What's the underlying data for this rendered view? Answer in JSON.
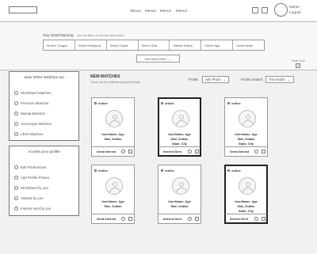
{
  "nav": [
    "Menu1",
    "Menu2",
    "Menu3",
    "Menu4"
  ],
  "header": {
    "name": "Name",
    "logout": "Logout"
  },
  "search": {
    "greeting": "Hey Good Morning",
    "hint": "Use the filters to find the ideal Match",
    "filters": [
      "Mother Tongue",
      "Select Religious",
      "Select Caste",
      "Select Star",
      "Marital Status",
      "Select Age",
      "Select state"
    ],
    "more_filter": "Add More Filter",
    "scroll_top": "Scroll to top"
  },
  "sidebar": {
    "matches_title": "View Other Matches too",
    "matches_items": [
      "Shortlisted Matches",
      "Premium Matches",
      "Mutual Matches",
      "Horoscope Matches",
      "Liked Matches"
    ],
    "profile_title": "Access your profile",
    "profile_items": [
      "Edit Preferences",
      "Add Profile Picture",
      "Shortlisted by you",
      "Viewed by you",
      "Interest sent by you"
    ]
  },
  "main": {
    "title": "NEW MATCHES",
    "subtitle": "These are the matches joined Recently",
    "profile_label": "Profile",
    "profile_value": "with Photo",
    "created_label": "Profile created",
    "created_value": "This Month"
  },
  "cards": [
    {
      "status": "online",
      "name": "UserName, Age",
      "star": "Star, Zodiac",
      "location": "",
      "action": "Send Interest",
      "selected": false
    },
    {
      "status": "online",
      "name": "UserName, Age",
      "star": "Star, Zodiac",
      "location": "State, City",
      "action": "Interest Sent",
      "selected": true
    },
    {
      "status": "online",
      "name": "UserName, Age",
      "star": "Star, Zodiac",
      "location": "State, City",
      "action": "Send Interest",
      "selected": false
    },
    {
      "status": "online",
      "name": "UserName, Age",
      "star": "Star, Zodiac",
      "location": "",
      "action": "Send Interest",
      "selected": false
    },
    {
      "status": "online",
      "name": "UserName, Age",
      "star": "Star, Zodiac",
      "location": "",
      "action": "Interest Sent",
      "selected": false
    },
    {
      "status": "online",
      "name": "UserName, Age",
      "star": "Star, Zodiac",
      "location": "State, City",
      "action": "Interest Sent",
      "selected": true
    }
  ]
}
